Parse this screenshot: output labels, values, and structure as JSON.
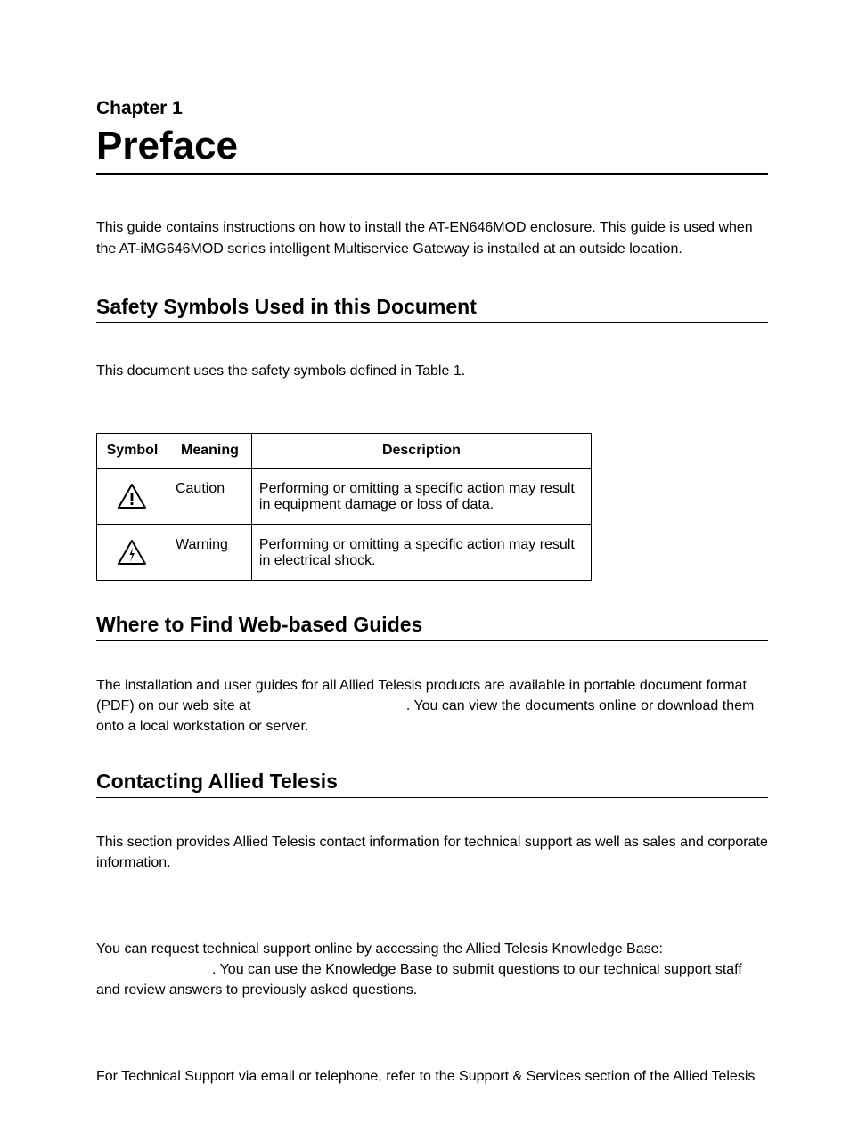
{
  "chapter": {
    "label": "Chapter 1",
    "title": "Preface"
  },
  "intro": "This guide contains instructions on how to install the AT-EN646MOD enclosure. This guide is used when the AT-iMG646MOD series intelligent Multiservice Gateway is installed at an outside location.",
  "sections": {
    "safety": {
      "heading": "Safety Symbols Used in this Document",
      "body": "This document uses the safety symbols defined in Table 1.",
      "table": {
        "headers": {
          "symbol": "Symbol",
          "meaning": "Meaning",
          "description": "Description"
        },
        "rows": [
          {
            "icon": "caution-icon",
            "meaning": "Caution",
            "description": "Performing or omitting a specific action may result in equipment damage or loss of data."
          },
          {
            "icon": "warning-icon",
            "meaning": "Warning",
            "description": "Performing or omitting a specific action may result in electrical shock."
          }
        ]
      }
    },
    "web_guides": {
      "heading": "Where to Find Web-based Guides",
      "body_before": "The installation and user guides for all Allied Telesis products are available in portable document format (PDF) on our web site at ",
      "body_after": ". You can view the documents online or download them onto a local workstation or server."
    },
    "contact": {
      "heading": "Contacting Allied Telesis",
      "body": "This section provides Allied Telesis contact information for technical support as well as sales and corporate information.",
      "support_online_before": "You can request technical support online by accessing the Allied Telesis Knowledge Base: ",
      "support_online_after": ". You can use the Knowledge Base to submit questions to our technical support staff and review answers to previously asked questions.",
      "support_phone": "For Technical Support via email or telephone, refer to the Support & Services section of the Allied Telesis"
    }
  }
}
